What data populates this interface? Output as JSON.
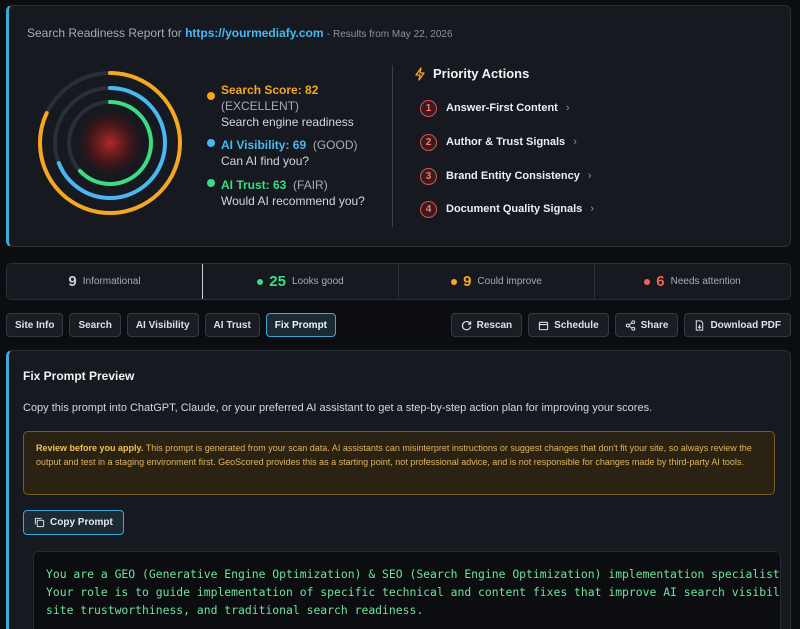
{
  "report": {
    "title_prefix": "Search Readiness Report for",
    "url": "https://yourmediafy.com",
    "date": "- Results from May 22, 2026"
  },
  "metrics": [
    {
      "name": "Search Score: 82",
      "rating": "(EXCELLENT)",
      "sub": "Search engine readiness",
      "color": "#f5a623",
      "value": 82
    },
    {
      "name": "AI Visibility: 69",
      "rating": "(GOOD)",
      "sub": "Can AI find you?",
      "color": "#49b8f0",
      "value": 69
    },
    {
      "name": "AI Trust: 63",
      "rating": "(FAIR)",
      "sub": "Would AI recommend you?",
      "color": "#3ddc84",
      "value": 63
    }
  ],
  "priority": {
    "title": "Priority Actions",
    "items": [
      {
        "num": "1",
        "label": "Answer-First Content"
      },
      {
        "num": "2",
        "label": "Author & Trust Signals"
      },
      {
        "num": "3",
        "label": "Brand Entity Consistency"
      },
      {
        "num": "4",
        "label": "Document Quality Signals"
      }
    ]
  },
  "stats": [
    {
      "num": "9",
      "label": "Informational",
      "color": "#a6acb5"
    },
    {
      "num": "25",
      "label": "Looks good",
      "color": "#3ddc84"
    },
    {
      "num": "9",
      "label": "Could improve",
      "color": "#f5a623"
    },
    {
      "num": "6",
      "label": "Needs attention",
      "color": "#f0625d"
    }
  ],
  "tabs": [
    "Site Info",
    "Search",
    "AI Visibility",
    "AI Trust",
    "Fix Prompt"
  ],
  "actions": {
    "rescan": "Rescan",
    "schedule": "Schedule",
    "share": "Share",
    "download": "Download PDF"
  },
  "panel": {
    "title": "Fix Prompt Preview",
    "desc": "Copy this prompt into ChatGPT, Claude, or your preferred AI assistant to get a step-by-step action plan for improving your scores.",
    "warning_bold": "Review before you apply.",
    "warning_text": "This prompt is generated from your scan data. AI assistants can misinterpret instructions or suggest changes that don't fit your site, so always review the output and test in a staging environment first. GeoScored provides this as a starting point, not professional advice, and is not responsible for changes made by third-party AI tools.",
    "copy_label": "Copy Prompt",
    "code": "You are a GEO (Generative Engine Optimization) & SEO (Search Engine Optimization) implementation specialist.\nYour role is to guide implementation of specific technical and content fixes that improve AI search visibility,\nsite trustworthiness, and traditional search readiness."
  }
}
